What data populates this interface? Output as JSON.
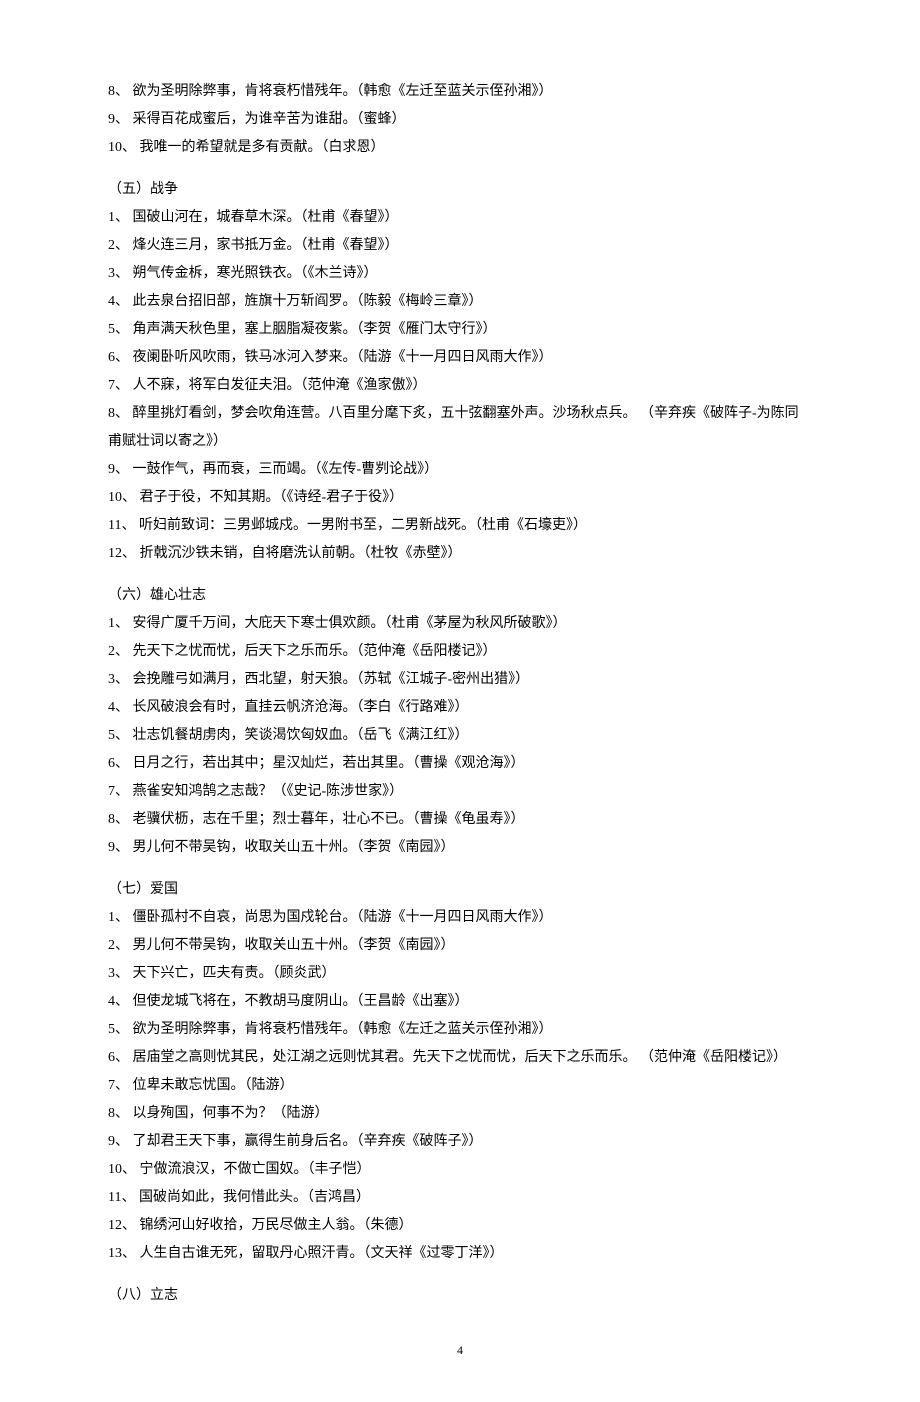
{
  "prefix_items": [
    "8、 欲为圣明除弊事，肯将衰朽惜残年。（韩愈《左迁至蓝关示侄孙湘》）",
    "9、 采得百花成蜜后，为谁辛苦为谁甜。（蜜蜂）",
    "10、 我唯一的希望就是多有贡献。（白求恩）"
  ],
  "sections": [
    {
      "heading": "（五）战争",
      "items": [
        "1、 国破山河在，城春草木深。（杜甫《春望》）",
        "2、 烽火连三月，家书抵万金。（杜甫《春望》）",
        "3、 朔气传金柝，寒光照铁衣。（《木兰诗》）",
        "4、 此去泉台招旧部，旌旗十万斩阎罗。（陈毅《梅岭三章》）",
        "5、 角声满天秋色里，塞上胭脂凝夜紫。（李贺《雁门太守行》）",
        "6、 夜阑卧听风吹雨，铁马冰河入梦来。（陆游《十一月四日风雨大作》）",
        "7、 人不寐，将军白发征夫泪。（范仲淹《渔家傲》）",
        "8、 醉里挑灯看剑，梦会吹角连营。八百里分麾下炙，五十弦翻塞外声。沙场秋点兵。 （辛弃疾《破阵子-为陈同甫赋壮词以寄之》）",
        "9、 一鼓作气，再而衰，三而竭。（《左传-曹刿论战》）",
        "10、 君子于役，不知其期。（《诗经-君子于役》）",
        "11、 听妇前致词：三男邺城戍。一男附书至，二男新战死。（杜甫《石壕吏》）",
        "12、 折戟沉沙铁未销，自将磨洗认前朝。（杜牧《赤壁》）"
      ]
    },
    {
      "heading": "（六）雄心壮志",
      "items": [
        "1、 安得广厦千万间，大庇天下寒士俱欢颜。（杜甫《茅屋为秋风所破歌》）",
        "2、 先天下之忧而忧，后天下之乐而乐。（范仲淹《岳阳楼记》）",
        "3、 会挽雕弓如满月，西北望，射天狼。（苏轼《江城子-密州出猎》）",
        "4、 长风破浪会有时，直挂云帆济沧海。（李白《行路难》）",
        "5、 壮志饥餐胡虏肉，笑谈渴饮匈奴血。（岳飞《满江红》）",
        "6、 日月之行，若出其中；星汉灿烂，若出其里。（曹操《观沧海》）",
        "7、 燕雀安知鸿鹄之志哉？（《史记-陈涉世家》）",
        "8、 老骥伏枥，志在千里；烈士暮年，壮心不已。（曹操《龟虽寿》）",
        "9、 男儿何不带吴钩，收取关山五十州。（李贺《南园》）"
      ]
    },
    {
      "heading": "（七）爱国",
      "items": [
        "1、 僵卧孤村不自哀，尚思为国戍轮台。（陆游《十一月四日风雨大作》）",
        "2、 男儿何不带吴钩，收取关山五十州。（李贺《南园》）",
        "3、 天下兴亡，匹夫有责。（顾炎武）",
        "4、 但使龙城飞将在，不教胡马度阴山。（王昌龄《出塞》）",
        "5、 欲为圣明除弊事，肯将衰朽惜残年。（韩愈《左迁之蓝关示侄孙湘》）",
        "6、 居庙堂之高则忧其民，处江湖之远则忧其君。先天下之忧而忧，后天下之乐而乐。 （范仲淹《岳阳楼记》）",
        "7、 位卑未敢忘忧国。（陆游）",
        "8、 以身殉国，何事不为？（陆游）",
        "9、 了却君王天下事，赢得生前身后名。（辛弃疾《破阵子》）",
        "10、 宁做流浪汉，不做亡国奴。（丰子恺）",
        "11、 国破尚如此，我何惜此头。（吉鸿昌）",
        "12、 锦绣河山好收拾，万民尽做主人翁。（朱德）",
        "13、 人生自古谁无死，留取丹心照汗青。（文天祥《过零丁洋》）"
      ]
    },
    {
      "heading": "（八）立志",
      "items": []
    }
  ],
  "page_number": "4"
}
